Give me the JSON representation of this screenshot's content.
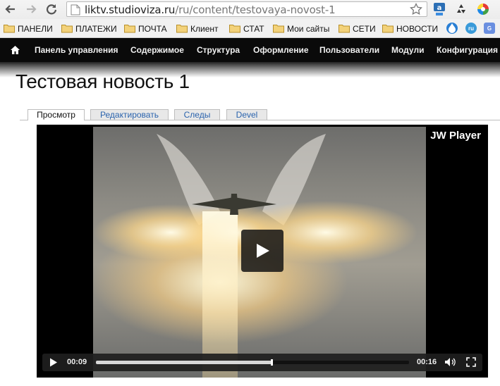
{
  "browser": {
    "url_host": "liktv.studioviza.ru",
    "url_path": "/ru/content/testovaya-novost-1",
    "bookmarks": [
      {
        "label": "ПАНЕЛИ"
      },
      {
        "label": "ПЛАТЕЖИ"
      },
      {
        "label": "ПОЧТА"
      },
      {
        "label": "Клиент"
      },
      {
        "label": "СТАТ"
      },
      {
        "label": "Мои сайты"
      },
      {
        "label": "СЕТИ"
      },
      {
        "label": "НОВОСТИ"
      }
    ]
  },
  "toolbar": {
    "items": [
      {
        "label": "Панель управления"
      },
      {
        "label": "Содержимое"
      },
      {
        "label": "Структура"
      },
      {
        "label": "Оформление"
      },
      {
        "label": "Пользователи"
      },
      {
        "label": "Модули"
      },
      {
        "label": "Конфигурация"
      }
    ]
  },
  "page": {
    "title": "Тестовая новость 1",
    "tabs": [
      {
        "label": "Просмотр",
        "active": true
      },
      {
        "label": "Редактировать",
        "active": false
      },
      {
        "label": "Следы",
        "active": false
      },
      {
        "label": "Devel",
        "active": false
      }
    ]
  },
  "player": {
    "brand": "JW Player",
    "elapsed": "00:09",
    "duration": "00:16",
    "progress_fraction": 0.56
  }
}
